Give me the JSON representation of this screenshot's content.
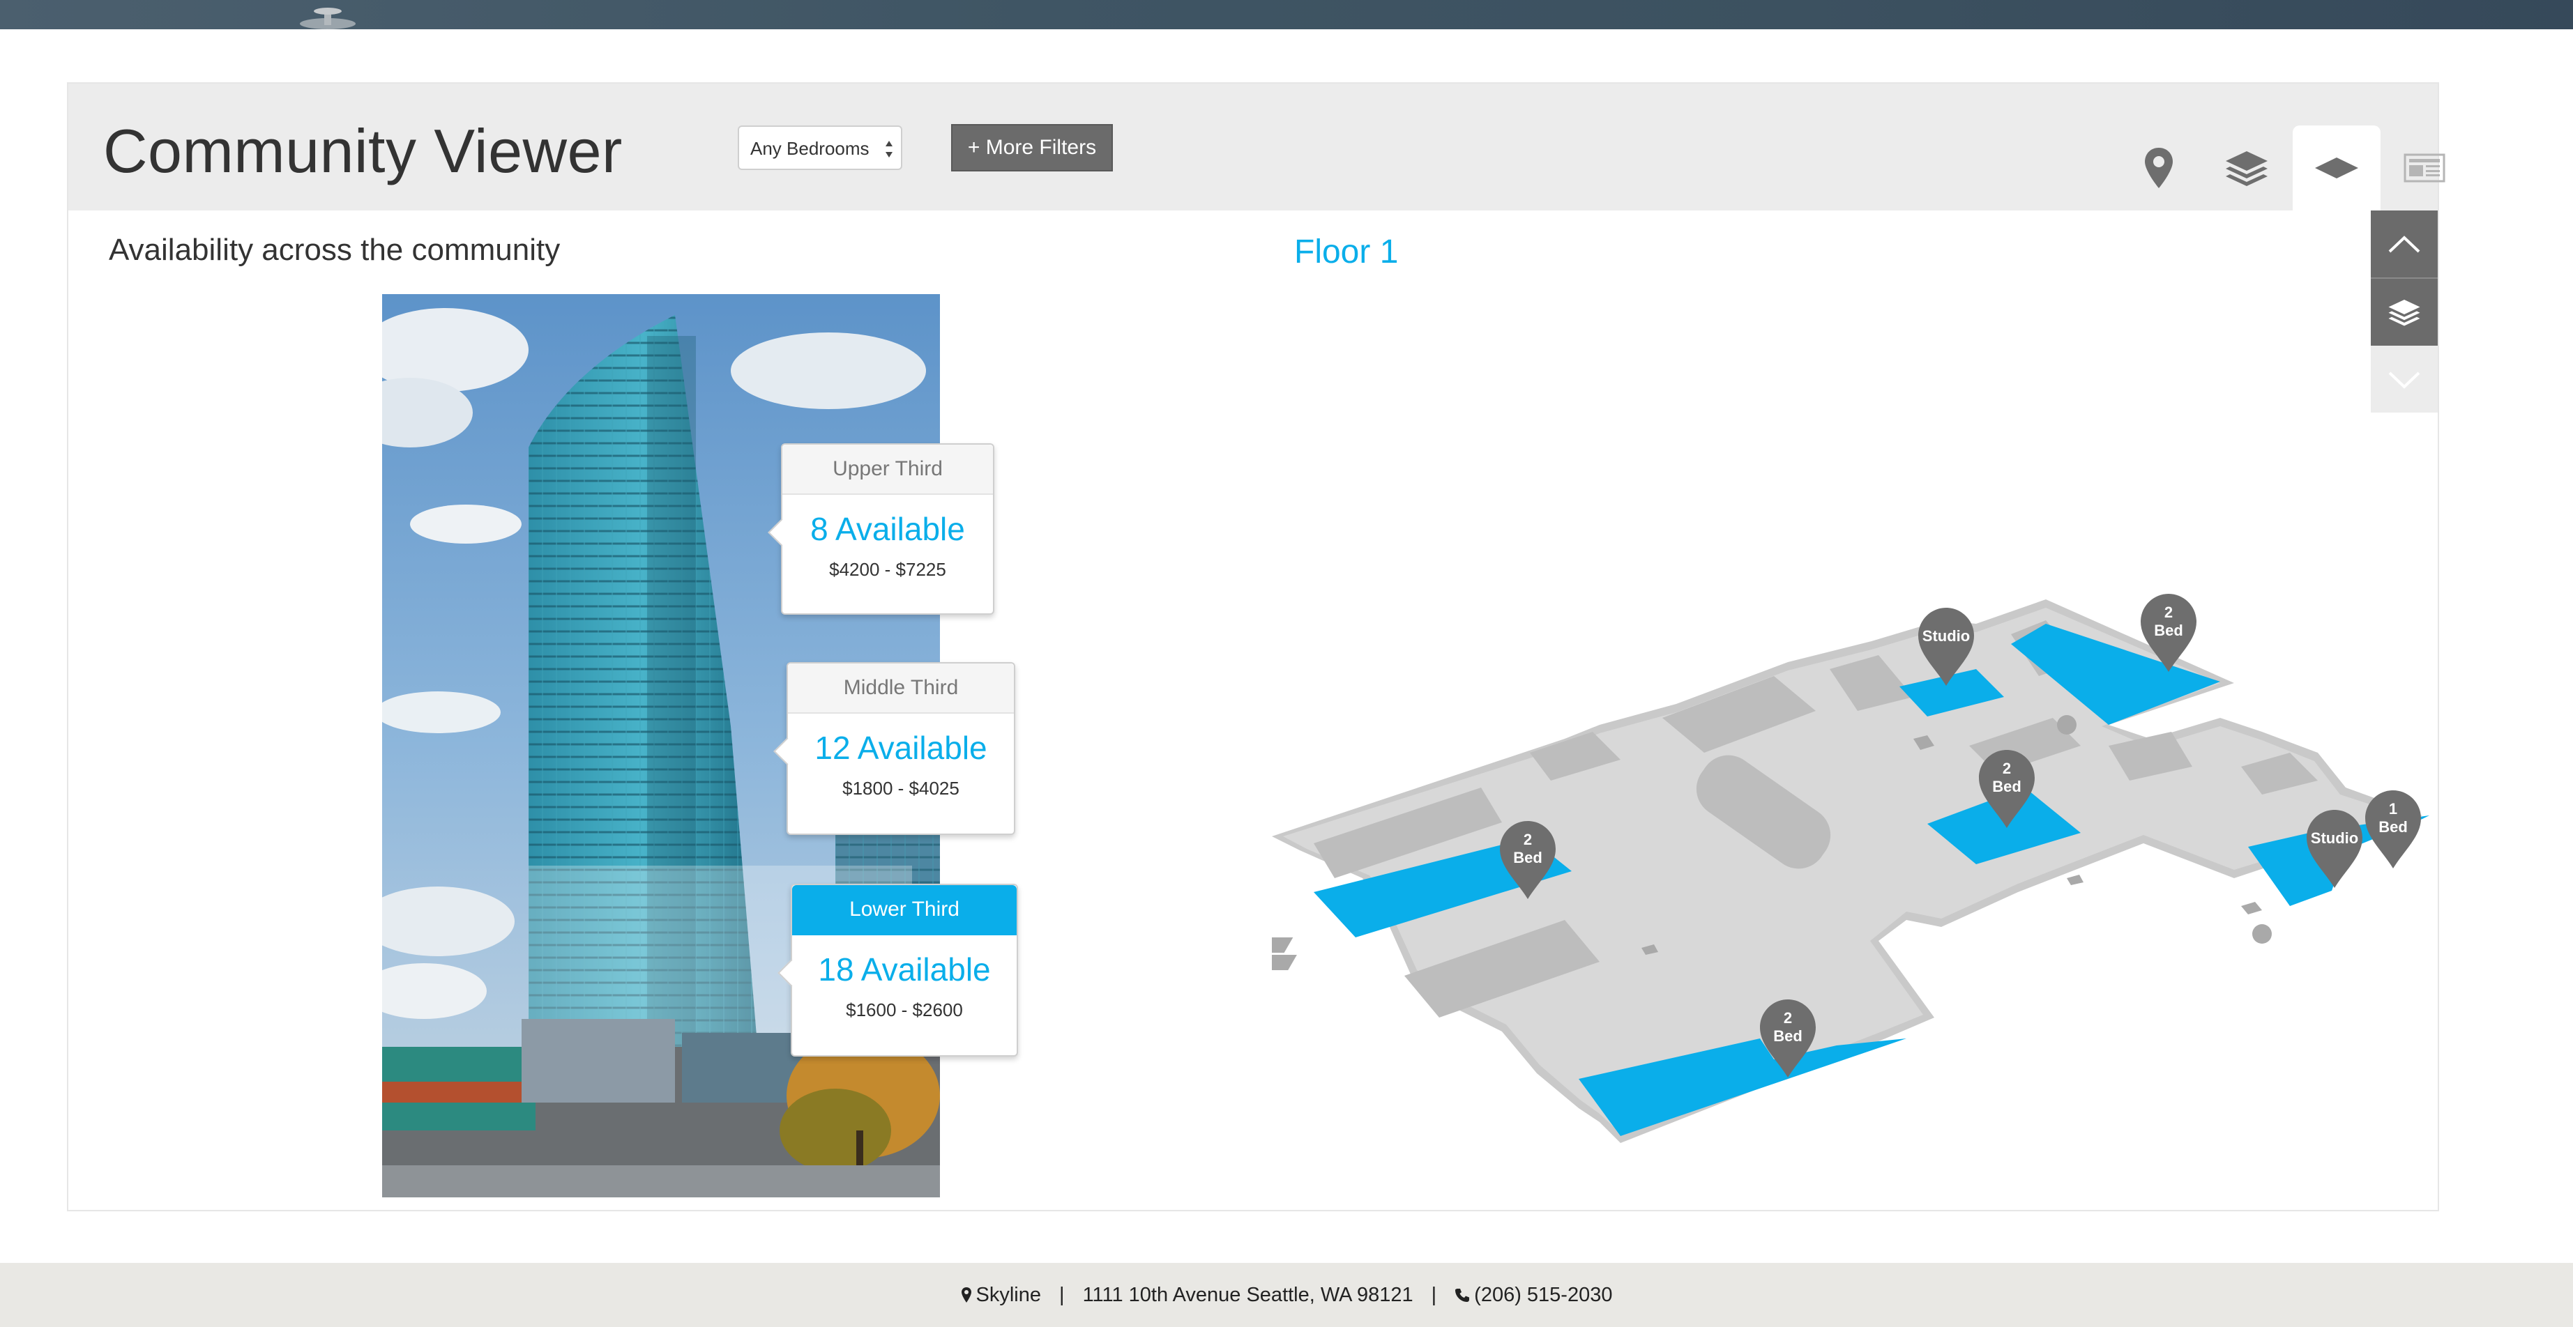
{
  "header": {
    "title": "Community Viewer",
    "bedrooms_select": {
      "value": "Any Bedrooms"
    },
    "more_filters_label": "+ More Filters",
    "tabs": [
      {
        "name": "map-tab",
        "icon": "map-marker-icon",
        "active": false
      },
      {
        "name": "stack-tab",
        "icon": "layers-icon",
        "active": false
      },
      {
        "name": "floor-tab",
        "icon": "floor-plate-icon",
        "active": true
      },
      {
        "name": "list-tab",
        "icon": "newspaper-icon",
        "active": false
      }
    ]
  },
  "side_nav": {
    "up_icon": "chevron-up-icon",
    "layers_icon": "layers-icon",
    "down_icon": "chevron-down-icon"
  },
  "availability": {
    "title": "Availability across the community",
    "sections": [
      {
        "label": "Upper Third",
        "count": "8 Available",
        "range": "$4200 - $7225",
        "active": false
      },
      {
        "label": "Middle Third",
        "count": "12 Available",
        "range": "$1800 - $4025",
        "active": false
      },
      {
        "label": "Lower Third",
        "count": "18 Available",
        "range": "$1600 - $2600",
        "active": true
      }
    ]
  },
  "floor": {
    "title": "Floor 1",
    "pins": [
      {
        "line1": "Studio",
        "line2": ""
      },
      {
        "line1": "2",
        "line2": "Bed"
      },
      {
        "line1": "2",
        "line2": "Bed"
      },
      {
        "line1": "2",
        "line2": "Bed"
      },
      {
        "line1": "Studio",
        "line2": ""
      },
      {
        "line1": "1",
        "line2": "Bed"
      },
      {
        "line1": "2",
        "line2": "Bed"
      }
    ],
    "colors": {
      "available": "#0aaeea",
      "floor": "#d9d9d9",
      "pin": "#6e6e6e"
    }
  },
  "footer": {
    "name": "Skyline",
    "address": "1111 10th Avenue  Seattle, WA 98121",
    "phone": "(206) 515-2030"
  }
}
